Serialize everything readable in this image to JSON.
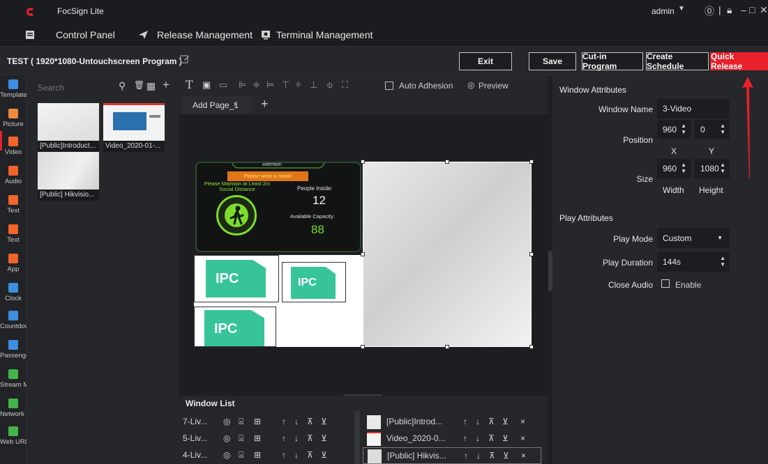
{
  "title_bar": {
    "app_name": "FocSign Lite",
    "user": "admin"
  },
  "menu": {
    "control_panel": "Control Panel",
    "release_management": "Release Management",
    "terminal_management": "Terminal Management"
  },
  "toolbar": {
    "program_title": "TEST ( 1920*1080-Untouchscreen Program )",
    "exit": "Exit",
    "save": "Save",
    "cut_in": "Cut-in Program",
    "create_schedule": "Create Schedule",
    "quick_release": "Quick Release"
  },
  "rail": {
    "items": [
      "Template",
      "Picture",
      "Video",
      "Audio",
      "Text",
      "Text",
      "App",
      "Clock",
      "Countdown",
      "Passenger Fl",
      "Stream Med",
      "Network Camer",
      "Web URL"
    ],
    "colors": [
      "#3d8de0",
      "#f08a3c",
      "#f0652a",
      "#f0652a",
      "#f0652a",
      "#f0652a",
      "#f0652a",
      "#3d8de0",
      "#3d8de0",
      "#3d8de0",
      "#43b54a",
      "#43b54a",
      "#43b54a"
    ]
  },
  "media": {
    "search_placeholder": "Search",
    "items": [
      "[Public]Introduct...",
      "Video_2020-01-...",
      "[Public] Hikvisio..."
    ]
  },
  "editor": {
    "auto_adhesion": "Auto Adhesion",
    "preview": "Preview",
    "page_tab": "Add Page_1"
  },
  "signage": {
    "attention": "Attention",
    "mask": "Please wear a mask!",
    "distance": "Please Maintain at Least 2m Social Distance",
    "people_inside_label": "People Inside:",
    "people_inside": "12",
    "capacity_label": "Available Capacity:",
    "capacity": "88",
    "ipc": "IPC"
  },
  "window_list": {
    "title": "Window List",
    "left": [
      "7-Liv...",
      "5-Liv...",
      "4-Liv..."
    ],
    "right": [
      "[Public]Introd...",
      "Video_2020-0...",
      "[Public] Hikvis..."
    ]
  },
  "attributes": {
    "window_section": "Window Attributes",
    "window_name_label": "Window Name",
    "window_name": "3-Video",
    "position_label": "Position",
    "pos_x": "960",
    "pos_y": "0",
    "x_label": "X",
    "y_label": "Y",
    "size_label": "Size",
    "width": "960",
    "height": "1080",
    "width_label": "Width",
    "height_label": "Height",
    "play_section": "Play Attributes",
    "play_mode_label": "Play Mode",
    "play_mode": "Custom",
    "play_duration_label": "Play Duration",
    "play_duration": "144s",
    "close_audio_label": "Close Audio",
    "enable_label": "Enable"
  },
  "colors": {
    "accent": "#e8212b",
    "signage_green": "#7bdc2a",
    "ipc_teal": "#38c49b"
  }
}
